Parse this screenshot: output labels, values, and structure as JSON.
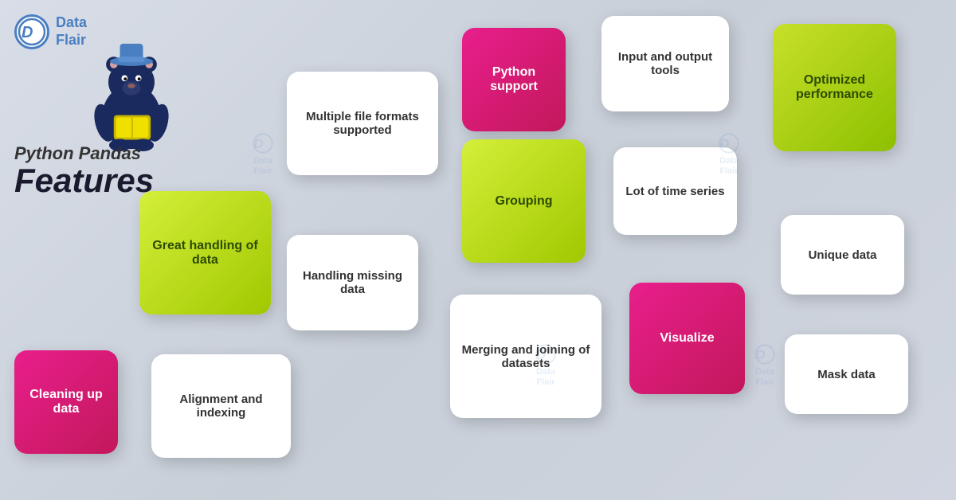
{
  "logo": {
    "data": "Data",
    "flair": "Flair"
  },
  "title": {
    "python_pandas": "Python Pandas",
    "features": "Features"
  },
  "cards": {
    "multiple": "Multiple file formats supported",
    "python": "Python support",
    "input": "Input and output tools",
    "optimized": "Optimized performance",
    "great": "Great handling of data",
    "grouping": "Grouping",
    "handling": "Handling missing data",
    "time": "Lot of time series",
    "unique": "Unique data",
    "merging": "Merging and joining of datasets",
    "visualize": "Visualize",
    "mask": "Mask data",
    "cleaning": "Cleaning up data",
    "alignment": "Alignment and indexing"
  },
  "watermark": {
    "label": "Data\nFlair"
  }
}
